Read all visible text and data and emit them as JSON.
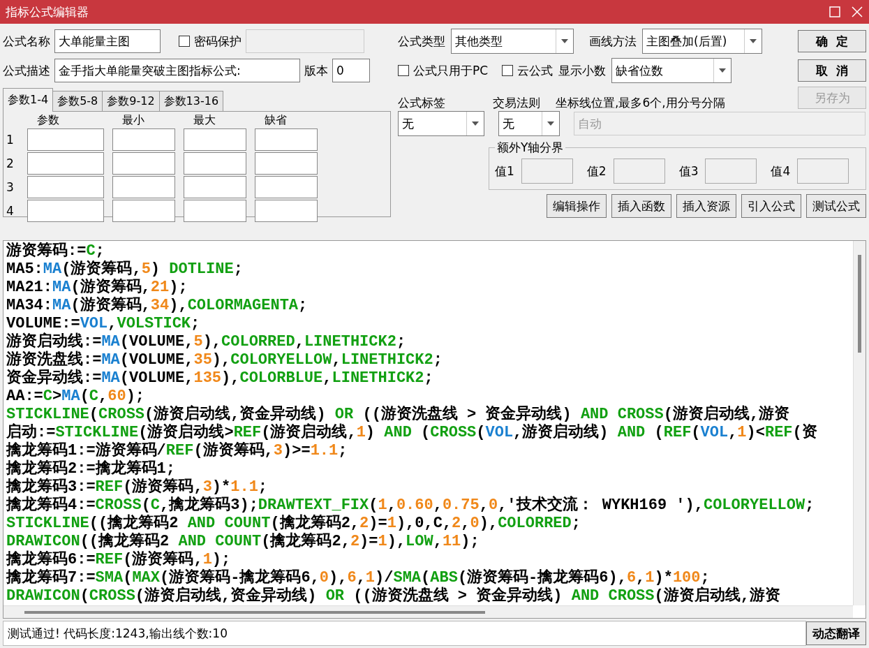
{
  "window": {
    "title": "指标公式编辑器"
  },
  "form": {
    "name_label": "公式名称",
    "name": "大单能量主图",
    "password": {
      "label": "密码保护",
      "checked": false
    },
    "desc_label": "公式描述",
    "desc": "金手指大单能量突破主图指标公式:",
    "version_label": "版本",
    "version": "0",
    "type": {
      "label": "公式类型",
      "value": "其他类型"
    },
    "draw_method": {
      "label": "画线方法",
      "value": "主图叠加(后置)"
    },
    "pc_only": {
      "label": "公式只用于PC",
      "checked": false
    },
    "cloud": {
      "label": "云公式",
      "checked": false
    },
    "decimals": {
      "label": "显示小数",
      "value": "缺省位数"
    },
    "tag": {
      "label": "公式标签",
      "value": "无"
    },
    "rule": {
      "label": "交易法则",
      "value": "无"
    },
    "axis": {
      "label": "坐标线位置,最多6个,用分号分隔",
      "placeholder": "自动",
      "disabled": true
    }
  },
  "side_buttons": [
    {
      "label": "确  定",
      "disabled": false
    },
    {
      "label": "取  消",
      "disabled": false
    },
    {
      "label": "另存为",
      "disabled": true
    }
  ],
  "tabs": [
    {
      "label": "参数1-4",
      "selected": true
    },
    {
      "label": "参数5-8",
      "selected": false
    },
    {
      "label": "参数9-12",
      "selected": false
    },
    {
      "label": "参数13-16",
      "selected": false
    }
  ],
  "params": {
    "columns": [
      "参数",
      "最小",
      "最大",
      "缺省"
    ],
    "rows": [
      "1",
      "2",
      "3",
      "4"
    ]
  },
  "y_bounds": {
    "title": "额外Y轴分界",
    "fields": [
      "值1",
      "值2",
      "值3",
      "值4"
    ]
  },
  "actions": [
    "编辑操作",
    "插入函数",
    "插入资源",
    "引入公式",
    "测试公式"
  ],
  "code": {
    "lines": [
      [
        {
          "kind": "plain",
          "text": "游资筹码:="
        },
        {
          "kind": "kw",
          "text": "C"
        },
        {
          "kind": "plain",
          "text": ";"
        }
      ],
      [
        {
          "kind": "plain",
          "text": "MA5:"
        },
        {
          "kind": "fn",
          "text": "MA"
        },
        {
          "kind": "plain",
          "text": "(游资筹码,"
        },
        {
          "kind": "num",
          "text": "5"
        },
        {
          "kind": "plain",
          "text": ") "
        },
        {
          "kind": "kw",
          "text": "DOTLINE"
        },
        {
          "kind": "plain",
          "text": ";"
        }
      ],
      [
        {
          "kind": "plain",
          "text": "MA21:"
        },
        {
          "kind": "fn",
          "text": "MA"
        },
        {
          "kind": "plain",
          "text": "(游资筹码,"
        },
        {
          "kind": "num",
          "text": "21"
        },
        {
          "kind": "plain",
          "text": ");"
        }
      ],
      [
        {
          "kind": "plain",
          "text": "MA34:"
        },
        {
          "kind": "fn",
          "text": "MA"
        },
        {
          "kind": "plain",
          "text": "(游资筹码,"
        },
        {
          "kind": "num",
          "text": "34"
        },
        {
          "kind": "plain",
          "text": "),"
        },
        {
          "kind": "kw",
          "text": "COLORMAGENTA"
        },
        {
          "kind": "plain",
          "text": ";"
        }
      ],
      [
        {
          "kind": "plain",
          "text": "VOLUME:="
        },
        {
          "kind": "fn",
          "text": "VOL"
        },
        {
          "kind": "plain",
          "text": ","
        },
        {
          "kind": "kw",
          "text": "VOLSTICK"
        },
        {
          "kind": "plain",
          "text": ";"
        }
      ],
      [
        {
          "kind": "plain",
          "text": "游资启动线:="
        },
        {
          "kind": "fn",
          "text": "MA"
        },
        {
          "kind": "plain",
          "text": "(VOLUME,"
        },
        {
          "kind": "num",
          "text": "5"
        },
        {
          "kind": "plain",
          "text": "),"
        },
        {
          "kind": "kw",
          "text": "COLORRED"
        },
        {
          "kind": "plain",
          "text": ","
        },
        {
          "kind": "kw",
          "text": "LINETHICK2"
        },
        {
          "kind": "plain",
          "text": ";"
        }
      ],
      [
        {
          "kind": "plain",
          "text": "游资洗盘线:="
        },
        {
          "kind": "fn",
          "text": "MA"
        },
        {
          "kind": "plain",
          "text": "(VOLUME,"
        },
        {
          "kind": "num",
          "text": "35"
        },
        {
          "kind": "plain",
          "text": "),"
        },
        {
          "kind": "kw",
          "text": "COLORYELLOW"
        },
        {
          "kind": "plain",
          "text": ","
        },
        {
          "kind": "kw",
          "text": "LINETHICK2"
        },
        {
          "kind": "plain",
          "text": ";"
        }
      ],
      [
        {
          "kind": "plain",
          "text": "资金异动线:="
        },
        {
          "kind": "fn",
          "text": "MA"
        },
        {
          "kind": "plain",
          "text": "(VOLUME,"
        },
        {
          "kind": "num",
          "text": "135"
        },
        {
          "kind": "plain",
          "text": "),"
        },
        {
          "kind": "kw",
          "text": "COLORBLUE"
        },
        {
          "kind": "plain",
          "text": ","
        },
        {
          "kind": "kw",
          "text": "LINETHICK2"
        },
        {
          "kind": "plain",
          "text": ";"
        }
      ],
      [
        {
          "kind": "plain",
          "text": "AA:="
        },
        {
          "kind": "kw",
          "text": "C"
        },
        {
          "kind": "plain",
          "text": ">"
        },
        {
          "kind": "fn",
          "text": "MA"
        },
        {
          "kind": "plain",
          "text": "("
        },
        {
          "kind": "kw",
          "text": "C"
        },
        {
          "kind": "plain",
          "text": ","
        },
        {
          "kind": "num",
          "text": "60"
        },
        {
          "kind": "plain",
          "text": ");"
        }
      ],
      [
        {
          "kind": "kw",
          "text": "STICKLINE"
        },
        {
          "kind": "plain",
          "text": "("
        },
        {
          "kind": "kw",
          "text": "CROSS"
        },
        {
          "kind": "plain",
          "text": "(游资启动线,资金异动线) "
        },
        {
          "kind": "kw",
          "text": "OR"
        },
        {
          "kind": "plain",
          "text": " ((游资洗盘线 > 资金异动线) "
        },
        {
          "kind": "kw",
          "text": "AND CROSS"
        },
        {
          "kind": "plain",
          "text": "(游资启动线,游资"
        }
      ],
      [
        {
          "kind": "plain",
          "text": "启动:="
        },
        {
          "kind": "kw",
          "text": "STICKLINE"
        },
        {
          "kind": "plain",
          "text": "(游资启动线>"
        },
        {
          "kind": "kw",
          "text": "REF"
        },
        {
          "kind": "plain",
          "text": "(游资启动线,"
        },
        {
          "kind": "num",
          "text": "1"
        },
        {
          "kind": "plain",
          "text": ") "
        },
        {
          "kind": "kw",
          "text": "AND"
        },
        {
          "kind": "plain",
          "text": " ("
        },
        {
          "kind": "kw",
          "text": "CROSS"
        },
        {
          "kind": "plain",
          "text": "("
        },
        {
          "kind": "fn",
          "text": "VOL"
        },
        {
          "kind": "plain",
          "text": ",游资启动线) "
        },
        {
          "kind": "kw",
          "text": "AND"
        },
        {
          "kind": "plain",
          "text": " ("
        },
        {
          "kind": "kw",
          "text": "REF"
        },
        {
          "kind": "plain",
          "text": "("
        },
        {
          "kind": "fn",
          "text": "VOL"
        },
        {
          "kind": "plain",
          "text": ","
        },
        {
          "kind": "num",
          "text": "1"
        },
        {
          "kind": "plain",
          "text": ")<"
        },
        {
          "kind": "kw",
          "text": "REF"
        },
        {
          "kind": "plain",
          "text": "(资"
        }
      ],
      [
        {
          "kind": "plain",
          "text": "擒龙筹码1:=游资筹码/"
        },
        {
          "kind": "kw",
          "text": "REF"
        },
        {
          "kind": "plain",
          "text": "(游资筹码,"
        },
        {
          "kind": "num",
          "text": "3"
        },
        {
          "kind": "plain",
          "text": ")>="
        },
        {
          "kind": "num",
          "text": "1.1"
        },
        {
          "kind": "plain",
          "text": ";"
        }
      ],
      [
        {
          "kind": "plain",
          "text": "擒龙筹码2:=擒龙筹码1;"
        }
      ],
      [
        {
          "kind": "plain",
          "text": "擒龙筹码3:="
        },
        {
          "kind": "kw",
          "text": "REF"
        },
        {
          "kind": "plain",
          "text": "(游资筹码,"
        },
        {
          "kind": "num",
          "text": "3"
        },
        {
          "kind": "plain",
          "text": ")*"
        },
        {
          "kind": "num",
          "text": "1.1"
        },
        {
          "kind": "plain",
          "text": ";"
        }
      ],
      [
        {
          "kind": "plain",
          "text": "擒龙筹码4:="
        },
        {
          "kind": "kw",
          "text": "CROSS"
        },
        {
          "kind": "plain",
          "text": "("
        },
        {
          "kind": "kw",
          "text": "C"
        },
        {
          "kind": "plain",
          "text": ",擒龙筹码3);"
        },
        {
          "kind": "kw",
          "text": "DRAWTEXT_FIX"
        },
        {
          "kind": "plain",
          "text": "("
        },
        {
          "kind": "num",
          "text": "1"
        },
        {
          "kind": "plain",
          "text": ","
        },
        {
          "kind": "num",
          "text": "0.60"
        },
        {
          "kind": "plain",
          "text": ","
        },
        {
          "kind": "num",
          "text": "0.75"
        },
        {
          "kind": "plain",
          "text": ","
        },
        {
          "kind": "num",
          "text": "0"
        },
        {
          "kind": "plain",
          "text": ",'技术交流： WYKH169 '),"
        },
        {
          "kind": "kw",
          "text": "COLORYELLOW"
        },
        {
          "kind": "plain",
          "text": ";"
        }
      ],
      [
        {
          "kind": "kw",
          "text": "STICKLINE"
        },
        {
          "kind": "plain",
          "text": "((擒龙筹码2 "
        },
        {
          "kind": "kw",
          "text": "AND COUNT"
        },
        {
          "kind": "plain",
          "text": "(擒龙筹码2,"
        },
        {
          "kind": "num",
          "text": "2"
        },
        {
          "kind": "plain",
          "text": ")="
        },
        {
          "kind": "num",
          "text": "1"
        },
        {
          "kind": "plain",
          "text": "),0,C,"
        },
        {
          "kind": "num",
          "text": "2"
        },
        {
          "kind": "plain",
          "text": ","
        },
        {
          "kind": "num",
          "text": "0"
        },
        {
          "kind": "plain",
          "text": "),"
        },
        {
          "kind": "kw",
          "text": "COLORRED"
        },
        {
          "kind": "plain",
          "text": ";"
        }
      ],
      [
        {
          "kind": "kw",
          "text": "DRAWICON"
        },
        {
          "kind": "plain",
          "text": "((擒龙筹码2 "
        },
        {
          "kind": "kw",
          "text": "AND COUNT"
        },
        {
          "kind": "plain",
          "text": "(擒龙筹码2,"
        },
        {
          "kind": "num",
          "text": "2"
        },
        {
          "kind": "plain",
          "text": ")="
        },
        {
          "kind": "num",
          "text": "1"
        },
        {
          "kind": "plain",
          "text": "),"
        },
        {
          "kind": "kw",
          "text": "LOW"
        },
        {
          "kind": "plain",
          "text": ","
        },
        {
          "kind": "num",
          "text": "11"
        },
        {
          "kind": "plain",
          "text": ");"
        }
      ],
      [
        {
          "kind": "plain",
          "text": "擒龙筹码6:="
        },
        {
          "kind": "kw",
          "text": "REF"
        },
        {
          "kind": "plain",
          "text": "(游资筹码,"
        },
        {
          "kind": "num",
          "text": "1"
        },
        {
          "kind": "plain",
          "text": ");"
        }
      ],
      [
        {
          "kind": "plain",
          "text": "擒龙筹码7:="
        },
        {
          "kind": "kw",
          "text": "SMA"
        },
        {
          "kind": "plain",
          "text": "("
        },
        {
          "kind": "kw",
          "text": "MAX"
        },
        {
          "kind": "plain",
          "text": "(游资筹码-擒龙筹码6,"
        },
        {
          "kind": "num",
          "text": "0"
        },
        {
          "kind": "plain",
          "text": "),"
        },
        {
          "kind": "num",
          "text": "6"
        },
        {
          "kind": "plain",
          "text": ","
        },
        {
          "kind": "num",
          "text": "1"
        },
        {
          "kind": "plain",
          "text": ")/"
        },
        {
          "kind": "kw",
          "text": "SMA"
        },
        {
          "kind": "plain",
          "text": "("
        },
        {
          "kind": "kw",
          "text": "ABS"
        },
        {
          "kind": "plain",
          "text": "(游资筹码-擒龙筹码6),"
        },
        {
          "kind": "num",
          "text": "6"
        },
        {
          "kind": "plain",
          "text": ","
        },
        {
          "kind": "num",
          "text": "1"
        },
        {
          "kind": "plain",
          "text": ")*"
        },
        {
          "kind": "num",
          "text": "100"
        },
        {
          "kind": "plain",
          "text": ";"
        }
      ],
      [
        {
          "kind": "kw",
          "text": "DRAWICON"
        },
        {
          "kind": "plain",
          "text": "("
        },
        {
          "kind": "kw",
          "text": "CROSS"
        },
        {
          "kind": "plain",
          "text": "(游资启动线,资金异动线) "
        },
        {
          "kind": "kw",
          "text": "OR"
        },
        {
          "kind": "plain",
          "text": " ((游资洗盘线 > 资金异动线) "
        },
        {
          "kind": "kw",
          "text": "AND CROSS"
        },
        {
          "kind": "plain",
          "text": "(游资启动线,游资"
        }
      ]
    ]
  },
  "status": {
    "message": "测试通过! 代码长度:1243,输出线个数:10",
    "button": "动态翻译"
  }
}
